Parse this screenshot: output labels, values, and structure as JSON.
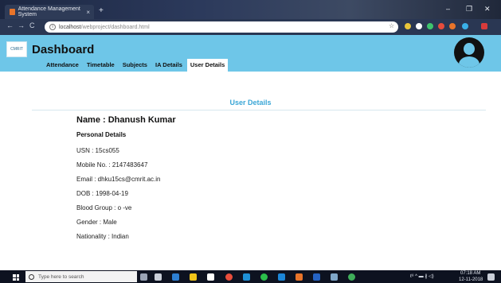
{
  "browser": {
    "tab_title": "Attendance Management System",
    "tab_close": "×",
    "new_tab": "+",
    "url_host": "localhost",
    "url_path": "/webproject/dashboard.html",
    "minimize": "–",
    "maximize": "❐",
    "close": "✕",
    "back": "←",
    "forward": "→",
    "reload": "C",
    "star": "☆"
  },
  "header": {
    "logo_text": "CMRIT",
    "title": "Dashboard",
    "nav": [
      {
        "label": "Attendance"
      },
      {
        "label": "Timetable"
      },
      {
        "label": "Subjects"
      },
      {
        "label": "IA Details"
      },
      {
        "label": "User Details"
      }
    ],
    "active_nav": "User Details"
  },
  "content": {
    "section_title": "User Details",
    "name": "Name : Dhanush Kumar",
    "personal_heading": "Personal Details",
    "details": [
      "USN : 15cs055",
      "Mobile No. : 2147483647",
      "Email : dhku15cs@cmrit.ac.in",
      "DOB : 1998-04-19",
      "Blood Group : o -ve",
      "Gender : Male",
      "Nationality : Indian"
    ]
  },
  "taskbar": {
    "search_placeholder": "Type here to search",
    "time": "07:18 AM",
    "date": "12-11-2018",
    "tray_symbols": "ℓ⁸ ^ ▬ ∦ ◁)"
  },
  "colors": {
    "header_bg": "#6ec6e8",
    "accent": "#3aa6d6"
  }
}
